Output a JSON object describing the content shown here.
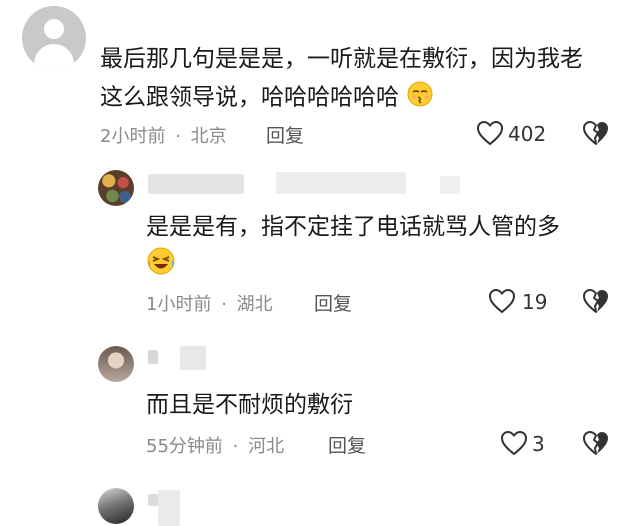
{
  "comment": {
    "line1": "最后那几句是是是，一听就是在敷衍，因为我老",
    "line2": "这么跟领导说，哈哈哈哈哈哈",
    "emoji": "kissing-face",
    "time": "2小时前",
    "location": "北京",
    "reply_label": "回复",
    "likes": "402"
  },
  "replies": [
    {
      "text_line1": "是是是有，指不定挂了电话就骂人管的多",
      "emoji": "laughing-crying-face",
      "time": "1小时前",
      "location": "湖北",
      "reply_label": "回复",
      "likes": "19"
    },
    {
      "text_line1": "而且是不耐烦的敷衍",
      "time": "55分钟前",
      "location": "河北",
      "reply_label": "回复",
      "likes": "3"
    }
  ],
  "separator": "·",
  "colors": {
    "text": "#1a1a1a",
    "meta": "#8a8a8a",
    "icon": "#333333"
  }
}
